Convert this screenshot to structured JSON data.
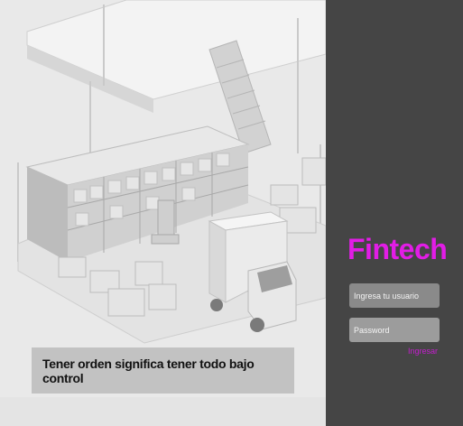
{
  "hero": {
    "caption": "Tener orden significa tener todo bajo control"
  },
  "login": {
    "brand": "Fintech",
    "username_placeholder": "Ingresa tu usuario",
    "password_placeholder": "Password",
    "submit_label": "Ingresar"
  },
  "colors": {
    "panel_bg": "#454545",
    "brand": "#e21de6",
    "link": "#c51ecf",
    "field_bg": "#8a8a8a"
  }
}
